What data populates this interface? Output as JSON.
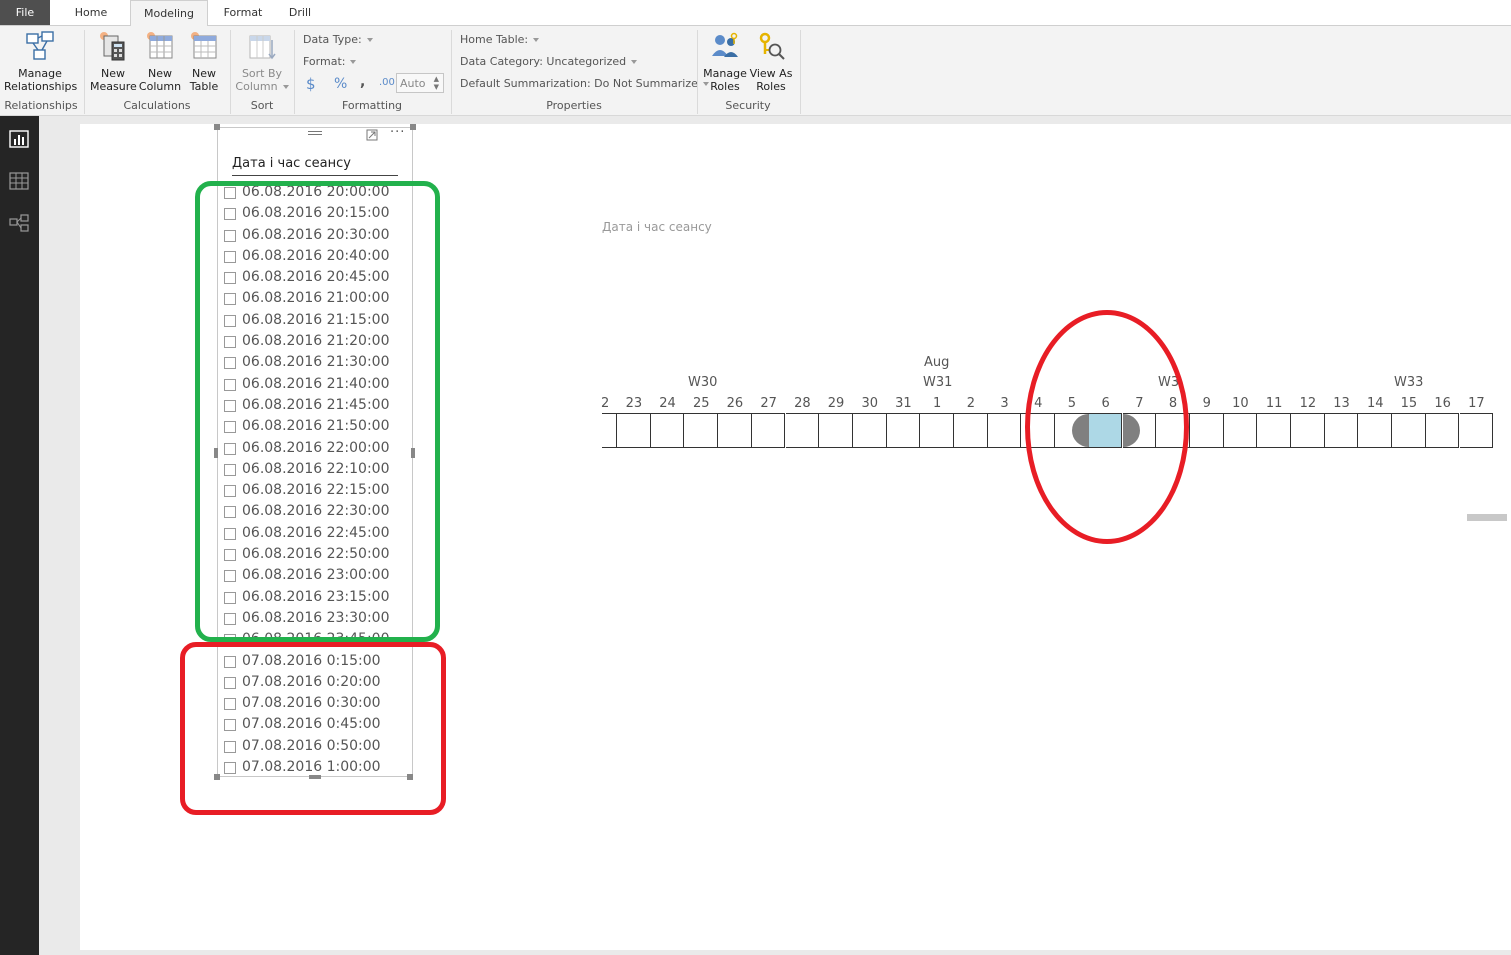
{
  "tabs": {
    "file": "File",
    "home": "Home",
    "modeling": "Modeling",
    "format": "Format",
    "drill": "Drill"
  },
  "ribbon": {
    "relationships": {
      "button_line1": "Manage",
      "button_line2": "Relationships",
      "group": "Relationships"
    },
    "calculations": {
      "new_measure_1": "New",
      "new_measure_2": "Measure",
      "new_column_1": "New",
      "new_column_2": "Column",
      "new_table_1": "New",
      "new_table_2": "Table",
      "group": "Calculations"
    },
    "sort": {
      "line1": "Sort By",
      "line2": "Column",
      "group": "Sort"
    },
    "formatting": {
      "data_type": "Data Type:",
      "format": "Format:",
      "currency": "$",
      "percent": "%",
      "comma": ",",
      "decimals": ".00",
      "auto": "Auto",
      "group": "Formatting"
    },
    "properties": {
      "home_table": "Home Table:",
      "data_category": "Data Category: Uncategorized",
      "default_summarization": "Default Summarization: Do Not Summarize",
      "group": "Properties"
    },
    "security": {
      "manage_roles_1": "Manage",
      "manage_roles_2": "Roles",
      "view_as_1": "View As",
      "view_as_2": "Roles",
      "group": "Security"
    }
  },
  "slicer": {
    "title": "Дата і час сеансу",
    "items": [
      "06.08.2016 20:00:00",
      "06.08.2016 20:15:00",
      "06.08.2016 20:30:00",
      "06.08.2016 20:40:00",
      "06.08.2016 20:45:00",
      "06.08.2016 21:00:00",
      "06.08.2016 21:15:00",
      "06.08.2016 21:20:00",
      "06.08.2016 21:30:00",
      "06.08.2016 21:40:00",
      "06.08.2016 21:45:00",
      "06.08.2016 21:50:00",
      "06.08.2016 22:00:00",
      "06.08.2016 22:10:00",
      "06.08.2016 22:15:00",
      "06.08.2016 22:30:00",
      "06.08.2016 22:45:00",
      "06.08.2016 22:50:00",
      "06.08.2016 23:00:00",
      "06.08.2016 23:15:00",
      "06.08.2016 23:30:00",
      "06.08.2016 23:45:00",
      "07.08.2016 0:15:00",
      "07.08.2016 0:20:00",
      "07.08.2016 0:30:00",
      "07.08.2016 0:45:00",
      "07.08.2016 0:50:00",
      "07.08.2016 1:00:00"
    ]
  },
  "timeline": {
    "title": "Дата і час сеансу",
    "month": "Aug",
    "weeks": [
      "W30",
      "W31",
      "W3",
      "W33"
    ],
    "days": [
      "2",
      "23",
      "24",
      "25",
      "26",
      "27",
      "28",
      "29",
      "30",
      "31",
      "1",
      "2",
      "3",
      "4",
      "5",
      "6",
      "7",
      "8",
      "9",
      "10",
      "11",
      "12",
      "13",
      "14",
      "15",
      "16",
      "17"
    ],
    "selected_day": "6",
    "selection_color": "#add8e6"
  },
  "colors": {
    "annotation_green": "#22b14c",
    "annotation_red": "#e81d25",
    "nav_background": "#252525"
  }
}
